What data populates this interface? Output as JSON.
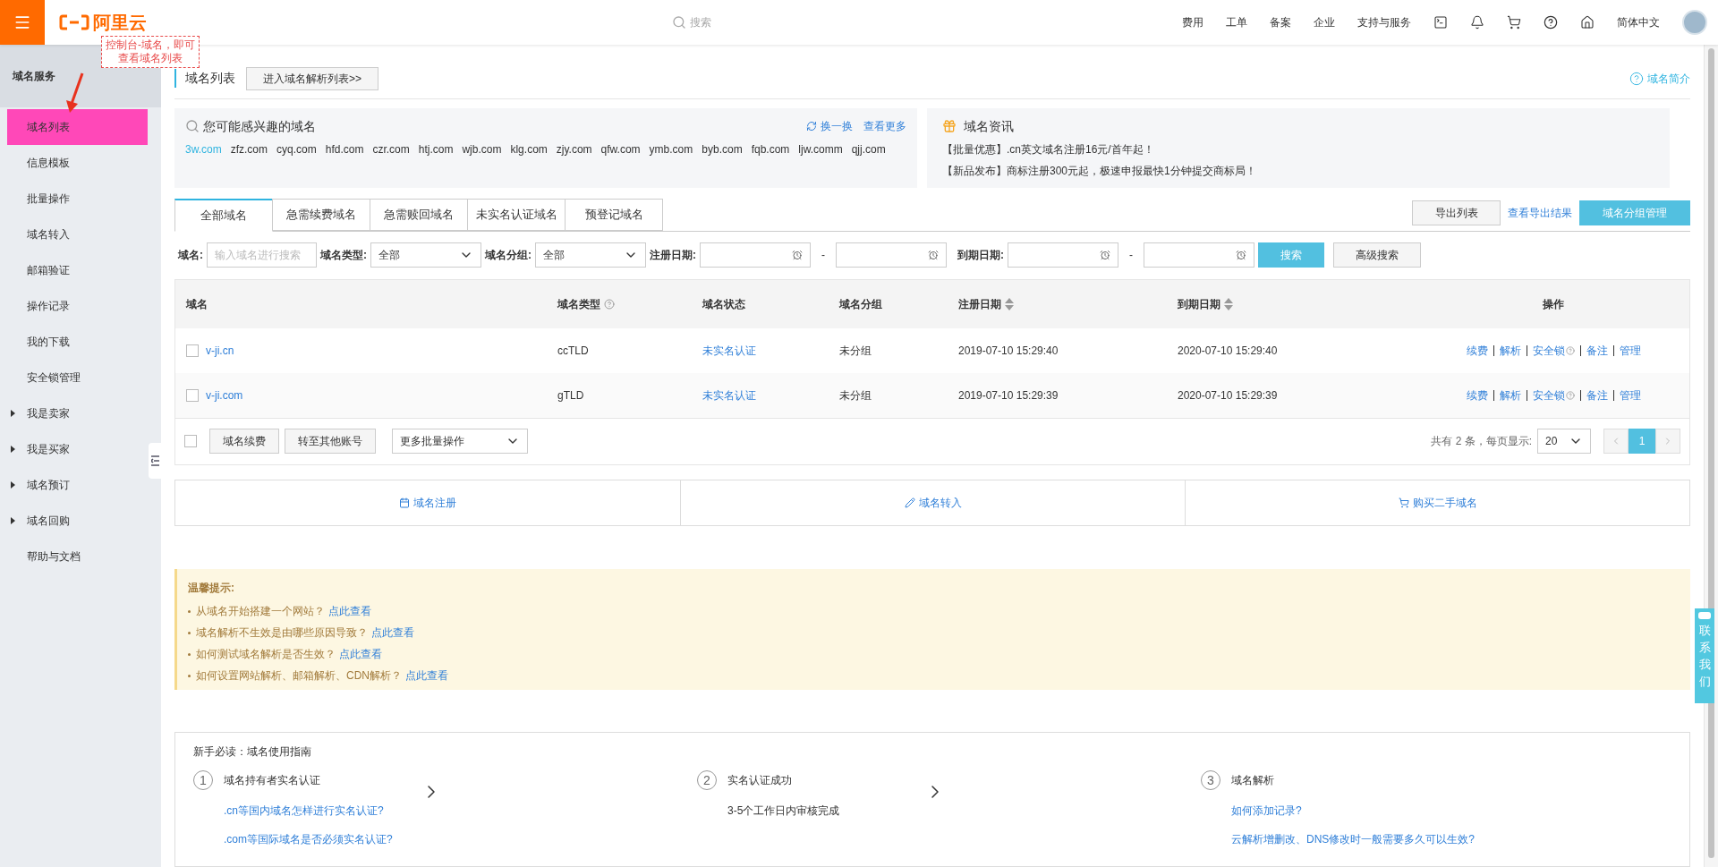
{
  "header": {
    "logo_text": "阿里云",
    "search_placeholder": "搜索",
    "nav": [
      "费用",
      "工单",
      "备案",
      "企业",
      "支持与服务"
    ],
    "language": "简体中文"
  },
  "annotation": {
    "text": "控制台-域名，即可查看域名列表"
  },
  "sidebar": {
    "title": "域名服务",
    "items": [
      {
        "label": "域名列表",
        "kind": "item",
        "selected": true
      },
      {
        "label": "信息模板",
        "kind": "item",
        "selected": false
      },
      {
        "label": "批量操作",
        "kind": "item",
        "selected": false
      },
      {
        "label": "域名转入",
        "kind": "item",
        "selected": false
      },
      {
        "label": "邮箱验证",
        "kind": "item",
        "selected": false
      },
      {
        "label": "操作记录",
        "kind": "item",
        "selected": false
      },
      {
        "label": "我的下载",
        "kind": "item",
        "selected": false
      },
      {
        "label": "安全锁管理",
        "kind": "item",
        "selected": false
      },
      {
        "label": "我是卖家",
        "kind": "group",
        "selected": false
      },
      {
        "label": "我是买家",
        "kind": "group",
        "selected": false
      },
      {
        "label": "域名预订",
        "kind": "group",
        "selected": false
      },
      {
        "label": "域名回购",
        "kind": "group",
        "selected": false
      },
      {
        "label": "帮助与文档",
        "kind": "item",
        "selected": false
      }
    ]
  },
  "page": {
    "title": "域名列表",
    "resolve_button": "进入域名解析列表>>",
    "intro_link": "域名简介"
  },
  "recommend": {
    "title": "您可能感兴趣的域名",
    "swap_label": "换一换",
    "more_label": "查看更多",
    "domains": [
      {
        "name": "3w.com",
        "highlighted": true
      },
      {
        "name": "zfz.com",
        "highlighted": false
      },
      {
        "name": "cyq.com",
        "highlighted": false
      },
      {
        "name": "hfd.com",
        "highlighted": false
      },
      {
        "name": "czr.com",
        "highlighted": false
      },
      {
        "name": "htj.com",
        "highlighted": false
      },
      {
        "name": "wjb.com",
        "highlighted": false
      },
      {
        "name": "klg.com",
        "highlighted": false
      },
      {
        "name": "zjy.com",
        "highlighted": false
      },
      {
        "name": "qfw.com",
        "highlighted": false
      },
      {
        "name": "ymb.com",
        "highlighted": false
      },
      {
        "name": "byb.com",
        "highlighted": false
      },
      {
        "name": "fqb.com",
        "highlighted": false
      },
      {
        "name": "ljw.comm",
        "highlighted": false
      },
      {
        "name": "qjj.com",
        "highlighted": false
      }
    ]
  },
  "news": {
    "title": "域名资讯",
    "items": [
      "【批量优惠】.cn英文域名注册16元/首年起！",
      "【新品发布】商标注册300元起，极速申报最快1分钟提交商标局！"
    ]
  },
  "tabs": [
    {
      "label": "全部域名",
      "selected": true
    },
    {
      "label": "急需续费域名",
      "selected": false
    },
    {
      "label": "急需赎回域名",
      "selected": false
    },
    {
      "label": "未实名认证域名",
      "selected": false
    },
    {
      "label": "预登记域名",
      "selected": false
    }
  ],
  "toolbar": {
    "export_button": "导出列表",
    "view_export_link": "查看导出结果",
    "group_manage_button": "域名分组管理"
  },
  "filters": {
    "domain_label": "域名:",
    "domain_placeholder": "输入域名进行搜索",
    "type_label": "域名类型:",
    "type_value": "全部",
    "group_label": "域名分组:",
    "group_value": "全部",
    "registered_label": "注册日期:",
    "range_separator_1": "-",
    "expires_label": "到期日期:",
    "range_separator_2": "-",
    "search_button": "搜索",
    "advanced_button": "高级搜索"
  },
  "table": {
    "columns": [
      {
        "label": "域名",
        "kind": "plain"
      },
      {
        "label": "域名类型",
        "kind": "help"
      },
      {
        "label": "域名状态",
        "kind": "plain"
      },
      {
        "label": "域名分组",
        "kind": "plain"
      },
      {
        "label": "注册日期",
        "kind": "sort"
      },
      {
        "label": "到期日期",
        "kind": "sort"
      },
      {
        "label": "操作",
        "kind": "plain"
      }
    ],
    "rows": [
      {
        "checked": false,
        "domain": "v-ji.cn",
        "type": "ccTLD",
        "status": "未实名认证",
        "group": "未分组",
        "registered": "2019-07-10 15:29:40",
        "expires": "2020-07-10 15:29:40",
        "actions": [
          {
            "label": "续费",
            "kind": "link"
          },
          {
            "label": "解析",
            "kind": "link"
          },
          {
            "label": "安全锁",
            "kind": "help"
          },
          {
            "label": "备注",
            "kind": "link"
          },
          {
            "label": "管理",
            "kind": "link"
          }
        ]
      },
      {
        "checked": false,
        "domain": "v-ji.com",
        "type": "gTLD",
        "status": "未实名认证",
        "group": "未分组",
        "registered": "2019-07-10 15:29:39",
        "expires": "2020-07-10 15:29:39",
        "actions": [
          {
            "label": "续费",
            "kind": "link"
          },
          {
            "label": "解析",
            "kind": "link"
          },
          {
            "label": "安全锁",
            "kind": "help"
          },
          {
            "label": "备注",
            "kind": "link"
          },
          {
            "label": "管理",
            "kind": "link"
          }
        ]
      }
    ]
  },
  "table_footer": {
    "all_checked": false,
    "buttons": [
      "域名续费",
      "转至其他账号"
    ],
    "batch_select": "更多批量操作",
    "summary": "共有 2 条，每页显示:",
    "page_size": "20",
    "pages": [
      {
        "label": "1",
        "selected": true
      }
    ]
  },
  "quick_actions": [
    {
      "label": "域名注册",
      "kind": "register"
    },
    {
      "label": "域名转入",
      "kind": "transfer"
    },
    {
      "label": "购买二手域名",
      "kind": "cart"
    }
  ],
  "tips": {
    "title": "温馨提示:",
    "items": [
      {
        "text": "从域名开始搭建一个网站？",
        "link": "点此查看"
      },
      {
        "text": "域名解析不生效是由哪些原因导致？",
        "link": "点此查看"
      },
      {
        "text": "如何测试域名解析是否生效？",
        "link": "点此查看"
      },
      {
        "text": "如何设置网站解析、邮箱解析、CDN解析？",
        "link": "点此查看"
      }
    ]
  },
  "guide": {
    "title": "新手必读：域名使用指南",
    "steps": [
      {
        "number": "1",
        "title": "域名持有者实名认证",
        "lines": [
          {
            "text": ".cn等国内域名怎样进行实名认证?",
            "kind": "link"
          },
          {
            "text": ".com等国际域名是否必须实名认证?",
            "kind": "link"
          }
        ]
      },
      {
        "number": "2",
        "title": "实名认证成功",
        "lines": [
          {
            "text": "3-5个工作日内审核完成",
            "kind": "text"
          }
        ]
      },
      {
        "number": "3",
        "title": "域名解析",
        "lines": [
          {
            "text": "如何添加记录?",
            "kind": "link"
          },
          {
            "text": "云解析增删改、DNS修改时一般需要多久可以生效?",
            "kind": "link"
          }
        ]
      }
    ]
  },
  "contact": {
    "label": "联系我们"
  }
}
